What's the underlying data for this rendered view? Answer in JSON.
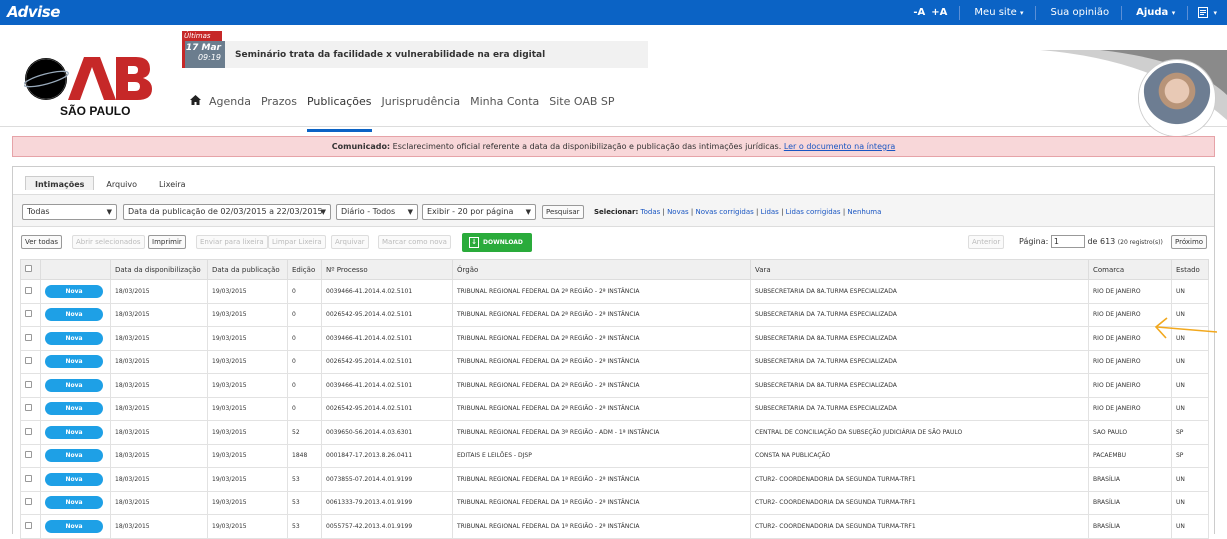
{
  "topbar": {
    "brand": "Advise",
    "links": [
      {
        "label": "-A",
        "bold": true
      },
      {
        "label": "+A",
        "bold": true
      },
      {
        "label": "Meu site",
        "dropdown": true
      },
      {
        "label": "Sua opinião",
        "dropdown": false
      },
      {
        "label": "Ajuda",
        "dropdown": true,
        "bold": true
      }
    ],
    "menu_icon": "document-icon"
  },
  "header": {
    "logo_text": "SÃO PAULO",
    "news_tag": "Últimas notícias",
    "news_date_day": "17 Mar",
    "news_date_time": "09:19",
    "news_headline": "Seminário trata da facilidade x vulnerabilidade na era digital",
    "nav": [
      "Agenda",
      "Prazos",
      "Publicações",
      "Jurisprudência",
      "Minha Conta",
      "Site OAB SP"
    ],
    "nav_active": "Publicações"
  },
  "notice": {
    "label": "Comunicado:",
    "text": " Esclarecimento oficial referente a data da disponibilização e publicação das intimações jurídicas. ",
    "link": "Ler o documento na íntegra"
  },
  "tabs": [
    "Intimações",
    "Arquivo",
    "Lixeira"
  ],
  "filters": {
    "status": "Todas",
    "period": "Data da publicação de 02/03/2015 a 22/03/2015",
    "diario": "Diário - Todos",
    "per_page": "Exibir - 20 por página",
    "search_button": "Pesquisar",
    "select_label": "Selecionar:",
    "select_options": [
      "Todas",
      "Novas",
      "Novas corrigidas",
      "Lidas",
      "Lidas corrigidas",
      "Nenhuma"
    ]
  },
  "actions": {
    "ver_todas": "Ver todas",
    "abrir": "Abrir selecionados",
    "imprimir": "Imprimir",
    "enviar": "Enviar para lixeira",
    "limpar": "Limpar Lixeira",
    "arquivar": "Arquivar",
    "marcar": "Marcar como nova",
    "download": "DOWNLOAD"
  },
  "pager": {
    "anterior": "Anterior",
    "pagina_label": "Página:",
    "pagina": "1",
    "total": "de 613",
    "registros": "(20 registro(s))",
    "proximo": "Próximo"
  },
  "table": {
    "headers": [
      "Data da disponibilização",
      "Data da publicação",
      "Edição",
      "Nº Processo",
      "Órgão",
      "Vara",
      "Comarca",
      "Estado"
    ],
    "badge": "Nova",
    "rows": [
      [
        "18/03/2015",
        "19/03/2015",
        "0",
        "0039466-41.2014.4.02.5101",
        "TRIBUNAL REGIONAL FEDERAL DA 2ª REGIÃO - 2ª INSTÂNCIA",
        "SUBSECRETARIA DA 8A.TURMA ESPECIALIZADA",
        "RIO DE JANEIRO",
        "UN"
      ],
      [
        "18/03/2015",
        "19/03/2015",
        "0",
        "0026542-95.2014.4.02.5101",
        "TRIBUNAL REGIONAL FEDERAL DA 2ª REGIÃO - 2ª INSTÂNCIA",
        "SUBSECRETARIA DA 7A.TURMA ESPECIALIZADA",
        "RIO DE JANEIRO",
        "UN"
      ],
      [
        "18/03/2015",
        "19/03/2015",
        "0",
        "0039466-41.2014.4.02.5101",
        "TRIBUNAL REGIONAL FEDERAL DA 2ª REGIÃO - 2ª INSTÂNCIA",
        "SUBSECRETARIA DA 8A.TURMA ESPECIALIZADA",
        "RIO DE JANEIRO",
        "UN"
      ],
      [
        "18/03/2015",
        "19/03/2015",
        "0",
        "0026542-95.2014.4.02.5101",
        "TRIBUNAL REGIONAL FEDERAL DA 2ª REGIÃO - 2ª INSTÂNCIA",
        "SUBSECRETARIA DA 7A.TURMA ESPECIALIZADA",
        "RIO DE JANEIRO",
        "UN"
      ],
      [
        "18/03/2015",
        "19/03/2015",
        "0",
        "0039466-41.2014.4.02.5101",
        "TRIBUNAL REGIONAL FEDERAL DA 2ª REGIÃO - 2ª INSTÂNCIA",
        "SUBSECRETARIA DA 8A.TURMA ESPECIALIZADA",
        "RIO DE JANEIRO",
        "UN"
      ],
      [
        "18/03/2015",
        "19/03/2015",
        "0",
        "0026542-95.2014.4.02.5101",
        "TRIBUNAL REGIONAL FEDERAL DA 2ª REGIÃO - 2ª INSTÂNCIA",
        "SUBSECRETARIA DA 7A.TURMA ESPECIALIZADA",
        "RIO DE JANEIRO",
        "UN"
      ],
      [
        "18/03/2015",
        "19/03/2015",
        "52",
        "0039650-56.2014.4.03.6301",
        "TRIBUNAL REGIONAL FEDERAL DA 3ª REGIÃO - ADM - 1ª INSTÂNCIA",
        "CENTRAL DE CONCILIAÇÃO DA SUBSEÇÃO JUDICIÁRIA DE SÃO PAULO",
        "SAO PAULO",
        "SP"
      ],
      [
        "18/03/2015",
        "19/03/2015",
        "1848",
        "0001847-17.2013.8.26.0411",
        "EDITAIS E LEILÕES - DJSP",
        "CONSTA NA PUBLICAÇÃO",
        "PACAEMBU",
        "SP"
      ],
      [
        "18/03/2015",
        "19/03/2015",
        "53",
        "0073855-07.2014.4.01.9199",
        "TRIBUNAL REGIONAL FEDERAL DA 1ª REGIÃO - 2ª INSTÂNCIA",
        "CTUR2- COORDENADORIA DA SEGUNDA TURMA-TRF1",
        "BRASÍLIA",
        "UN"
      ],
      [
        "18/03/2015",
        "19/03/2015",
        "53",
        "0061333-79.2013.4.01.9199",
        "TRIBUNAL REGIONAL FEDERAL DA 1ª REGIÃO - 2ª INSTÂNCIA",
        "CTUR2- COORDENADORIA DA SEGUNDA TURMA-TRF1",
        "BRASÍLIA",
        "UN"
      ],
      [
        "18/03/2015",
        "19/03/2015",
        "53",
        "0055757-42.2013.4.01.9199",
        "TRIBUNAL REGIONAL FEDERAL DA 1ª REGIÃO - 2ª INSTÂNCIA",
        "CTUR2- COORDENADORIA DA SEGUNDA TURMA-TRF1",
        "BRASÍLIA",
        "UN"
      ]
    ]
  },
  "colors": {
    "topbar": "#0b63c5",
    "badge": "#1ea0e6",
    "download": "#2aab3b",
    "notice_bg": "#f8d7d9",
    "arrow": "#f2a81d",
    "news_accent": "#c62828"
  }
}
